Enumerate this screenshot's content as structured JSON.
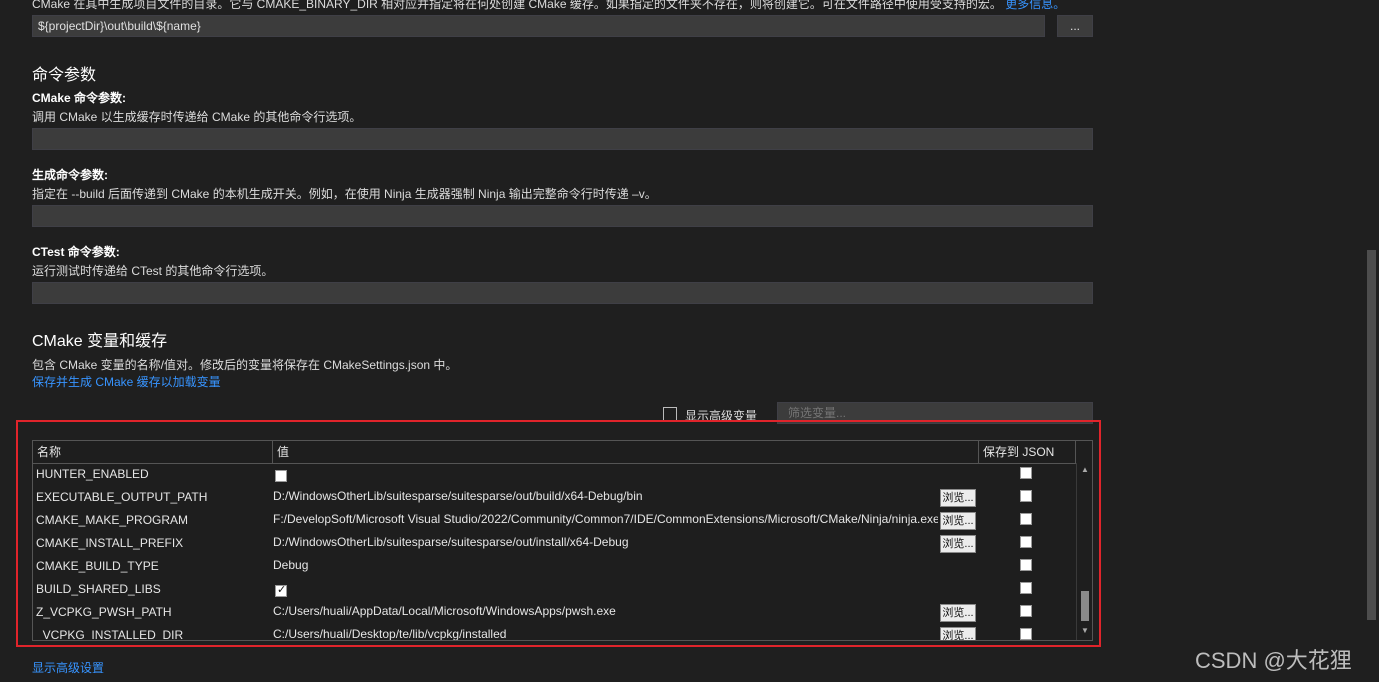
{
  "build_root": {
    "description": "CMake 在其中生成项目文件的目录。它与 CMAKE_BINARY_DIR 相对应并指定将在何处创建 CMake 缓存。如果指定的文件夹不存在，则将创建它。可在文件路径中使用受支持的宏。",
    "more_info_link": "更多信息。",
    "value": "${projectDir}\\out\\build\\${name}",
    "browse_label": "..."
  },
  "command_args": {
    "section_title": "命令参数",
    "cmake": {
      "title": "CMake 命令参数:",
      "description": "调用 CMake 以生成缓存时传递给 CMake 的其他命令行选项。",
      "value": ""
    },
    "build": {
      "title": "生成命令参数:",
      "description": "指定在 --build 后面传递到 CMake 的本机生成开关。例如，在使用 Ninja 生成器强制 Ninja 输出完整命令行时传递 –v。",
      "value": ""
    },
    "ctest": {
      "title": "CTest 命令参数:",
      "description": "运行测试时传递给 CTest 的其他命令行选项。",
      "value": ""
    }
  },
  "variables": {
    "section_title": "CMake 变量和缓存",
    "description": "包含 CMake 变量的名称/值对。修改后的变量将保存在 CMakeSettings.json 中。",
    "save_link": "保存并生成 CMake 缓存以加载变量",
    "show_advanced_label": "显示高级变量",
    "filter_placeholder": "筛选变量...",
    "columns": {
      "name": "名称",
      "value": "值",
      "save": "保存到 JSON"
    },
    "browse_label": "浏览...",
    "rows": [
      {
        "name": "HUNTER_ENABLED",
        "value": "",
        "value_checkbox": true,
        "value_checked": false,
        "browse": false,
        "save": false
      },
      {
        "name": "EXECUTABLE_OUTPUT_PATH",
        "value": "D:/WindowsOtherLib/suitesparse/suitesparse/out/build/x64-Debug/bin",
        "value_checkbox": false,
        "browse": true,
        "save": false
      },
      {
        "name": "CMAKE_MAKE_PROGRAM",
        "value": "F:/DevelopSoft/Microsoft Visual Studio/2022/Community/Common7/IDE/CommonExtensions/Microsoft/CMake/Ninja/ninja.exe",
        "value_checkbox": false,
        "browse": true,
        "save": false
      },
      {
        "name": "CMAKE_INSTALL_PREFIX",
        "value": "D:/WindowsOtherLib/suitesparse/suitesparse/out/install/x64-Debug",
        "value_checkbox": false,
        "browse": true,
        "save": false
      },
      {
        "name": "CMAKE_BUILD_TYPE",
        "value": "Debug",
        "value_checkbox": false,
        "browse": false,
        "save": false
      },
      {
        "name": "BUILD_SHARED_LIBS",
        "value": "",
        "value_checkbox": true,
        "value_checked": true,
        "browse": false,
        "save": false
      },
      {
        "name": "Z_VCPKG_PWSH_PATH",
        "value": "C:/Users/huali/AppData/Local/Microsoft/WindowsApps/pwsh.exe",
        "value_checkbox": false,
        "browse": true,
        "save": false
      },
      {
        "name": "_VCPKG_INSTALLED_DIR",
        "value": "C:/Users/huali/Desktop/te/lib/vcpkg/installed",
        "value_checkbox": false,
        "browse": true,
        "save": false
      }
    ]
  },
  "footer": {
    "show_advanced_settings": "显示高级设置"
  },
  "watermark": "CSDN @大花狸",
  "colors": {
    "highlight": "#e0242b",
    "link": "#3794ff",
    "background": "#1f1f1f"
  }
}
